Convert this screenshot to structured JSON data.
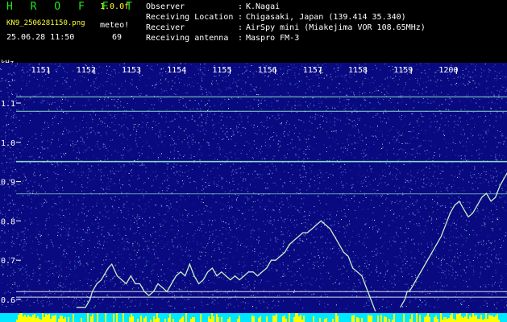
{
  "header": {
    "app_title": "H R O F F T",
    "version": "1.0.0f",
    "filename": "KN9_2506281150.png",
    "meteo_label": "meteo!",
    "timestamp": "25.06.28 11:50",
    "count": "69"
  },
  "info": [
    {
      "key": "Observer",
      "value": "K.Nagai"
    },
    {
      "key": "Receiving Location",
      "value": "Chigasaki, Japan (139.414 35.340)"
    },
    {
      "key": "Receiver",
      "value": "AirSpy mini (Miakejima VOR 108.65MHz)"
    },
    {
      "key": "Receiving antenna",
      "value": "Maspro FM-3"
    }
  ],
  "colors": {
    "background": "#0a0a80",
    "trace": "#c8f0c8",
    "hline": "#a0ffd0",
    "bottom_cyan": "#00e8ff",
    "bottom_yellow": "#ffff00",
    "title_green": "#1ee81e"
  },
  "axis": {
    "unit": "kHz",
    "y_ticks": [
      "1.1",
      "1.0",
      "0.9",
      "0.8",
      "0.7",
      "0.6"
    ],
    "x_ticks": [
      "1151",
      "1152",
      "1153",
      "1154",
      "1155",
      "1156",
      "1157",
      "1158",
      "1159",
      "1200"
    ]
  },
  "trace_points": [
    [
      0.0,
      0.58
    ],
    [
      0.1,
      0.58
    ],
    [
      0.2,
      0.58
    ],
    [
      0.3,
      0.6
    ],
    [
      0.35,
      0.62
    ],
    [
      0.45,
      0.64
    ],
    [
      0.55,
      0.65
    ],
    [
      0.7,
      0.68
    ],
    [
      0.78,
      0.69
    ],
    [
      0.9,
      0.66
    ],
    [
      1.0,
      0.65
    ],
    [
      1.1,
      0.64
    ],
    [
      1.2,
      0.66
    ],
    [
      1.3,
      0.64
    ],
    [
      1.4,
      0.64
    ],
    [
      1.5,
      0.62
    ],
    [
      1.6,
      0.61
    ],
    [
      1.7,
      0.62
    ],
    [
      1.8,
      0.64
    ],
    [
      1.9,
      0.63
    ],
    [
      2.0,
      0.62
    ],
    [
      2.1,
      0.64
    ],
    [
      2.2,
      0.66
    ],
    [
      2.3,
      0.67
    ],
    [
      2.4,
      0.66
    ],
    [
      2.5,
      0.69
    ],
    [
      2.6,
      0.66
    ],
    [
      2.7,
      0.64
    ],
    [
      2.8,
      0.65
    ],
    [
      2.9,
      0.67
    ],
    [
      3.0,
      0.68
    ],
    [
      3.1,
      0.66
    ],
    [
      3.2,
      0.67
    ],
    [
      3.3,
      0.66
    ],
    [
      3.4,
      0.65
    ],
    [
      3.5,
      0.66
    ],
    [
      3.6,
      0.65
    ],
    [
      3.7,
      0.66
    ],
    [
      3.8,
      0.67
    ],
    [
      3.9,
      0.67
    ],
    [
      4.0,
      0.66
    ],
    [
      4.1,
      0.67
    ],
    [
      4.2,
      0.68
    ],
    [
      4.3,
      0.7
    ],
    [
      4.4,
      0.7
    ],
    [
      4.5,
      0.71
    ],
    [
      4.6,
      0.72
    ],
    [
      4.7,
      0.74
    ],
    [
      4.8,
      0.75
    ],
    [
      4.9,
      0.76
    ],
    [
      5.0,
      0.77
    ],
    [
      5.1,
      0.77
    ],
    [
      5.2,
      0.78
    ],
    [
      5.3,
      0.79
    ],
    [
      5.4,
      0.8
    ],
    [
      5.5,
      0.79
    ],
    [
      5.6,
      0.78
    ],
    [
      5.7,
      0.76
    ],
    [
      5.8,
      0.74
    ],
    [
      5.9,
      0.72
    ],
    [
      6.0,
      0.71
    ],
    [
      6.1,
      0.68
    ],
    [
      6.2,
      0.67
    ],
    [
      6.3,
      0.66
    ],
    [
      6.4,
      0.63
    ],
    [
      6.5,
      0.6
    ],
    [
      6.6,
      0.57
    ],
    [
      8.4,
      0.58
    ],
    [
      8.5,
      0.6
    ],
    [
      8.55,
      0.62
    ],
    [
      8.6,
      0.62
    ],
    [
      8.7,
      0.64
    ],
    [
      8.8,
      0.66
    ],
    [
      8.9,
      0.68
    ],
    [
      9.0,
      0.7
    ],
    [
      9.1,
      0.72
    ],
    [
      9.2,
      0.74
    ],
    [
      9.3,
      0.76
    ],
    [
      9.4,
      0.79
    ],
    [
      9.5,
      0.82
    ],
    [
      9.6,
      0.84
    ],
    [
      9.7,
      0.85
    ],
    [
      9.8,
      0.83
    ],
    [
      9.9,
      0.81
    ],
    [
      10.0,
      0.82
    ],
    [
      10.1,
      0.84
    ],
    [
      10.2,
      0.86
    ],
    [
      10.3,
      0.87
    ],
    [
      10.4,
      0.85
    ],
    [
      10.5,
      0.86
    ],
    [
      10.6,
      0.89
    ],
    [
      10.7,
      0.91
    ],
    [
      10.8,
      0.93
    ],
    [
      10.9,
      0.95
    ],
    [
      11.0,
      0.95
    ],
    [
      11.05,
      0.94
    ]
  ],
  "hlines": [
    1.116,
    1.079,
    0.951,
    0.869,
    0.62,
    0.606
  ]
}
